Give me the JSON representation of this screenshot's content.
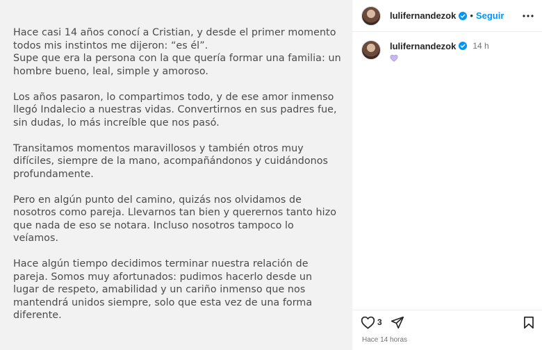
{
  "post": {
    "paragraphs": [
      [
        "Hace casi 14 años conocí a Cristian, y desde el primer momento",
        "todos mis instintos me dijeron: “es él”.",
        "Supe que era la persona con la que quería formar una familia: un",
        "hombre bueno, leal, simple y amoroso."
      ],
      [
        "Los años pasaron, lo compartimos todo, y de ese amor inmenso",
        "llegó Indalecio a nuestras vidas. Convertirnos en sus padres fue,",
        "sin dudas, lo más increíble que nos pasó."
      ],
      [
        "Transitamos momentos maravillosos y también otros muy",
        "difíciles, siempre de la mano, acompañándonos y cuidándonos",
        "profundamente."
      ],
      [
        "Pero en algún punto del camino, quizás nos olvidamos de",
        "nosotros como pareja. Llevarnos tan bien y querernos tanto hizo",
        "que nada de eso se notara. Incluso nosotros tampoco lo",
        "veíamos."
      ],
      [
        "Hace algún tiempo decidimos terminar nuestra relación de",
        "pareja. Somos muy afortunados: pudimos hacerlo desde un",
        "lugar de respeto, amabilidad y un cariño inmenso que nos",
        "mantendrá unidos siempre, solo que esta vez de una forma",
        "diferente."
      ]
    ]
  },
  "header": {
    "username": "lulifernandezok",
    "separator": "•",
    "follow_label": "Seguir"
  },
  "caption": {
    "username": "lulifernandezok",
    "time": "14 h",
    "emoji": "purple-heart-icon"
  },
  "actions": {
    "like_count": "3",
    "posted_ago": "Hace 14 horas"
  },
  "colors": {
    "accent": "#0095f6",
    "verified": "#0095f6",
    "heart_emoji": "#c9b8f0",
    "post_background": "#f2f2f2"
  }
}
